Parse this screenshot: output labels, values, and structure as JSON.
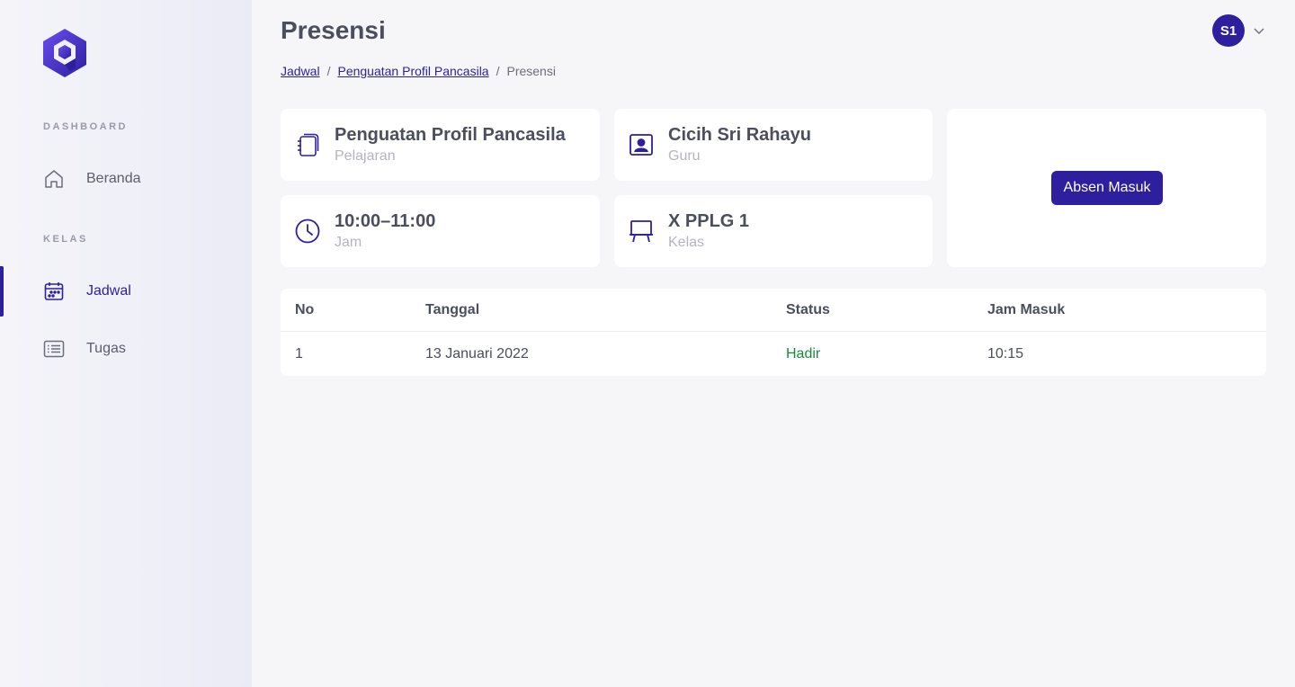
{
  "colors": {
    "primary": "#2d1f9e",
    "success": "#1a8a3e"
  },
  "sidebar": {
    "sections": [
      {
        "label": "DASHBOARD",
        "items": [
          {
            "label": "Beranda",
            "icon": "home-icon",
            "active": false
          }
        ]
      },
      {
        "label": "KELAS",
        "items": [
          {
            "label": "Jadwal",
            "icon": "calendar-icon",
            "active": true
          },
          {
            "label": "Tugas",
            "icon": "list-icon",
            "active": false
          }
        ]
      }
    ]
  },
  "header": {
    "title": "Presensi",
    "breadcrumb": [
      "Jadwal",
      "Penguatan Profil Pancasila",
      "Presensi"
    ],
    "avatar_initials": "S1"
  },
  "info": {
    "subject": {
      "value": "Penguatan Profil Pancasila",
      "label": "Pelajaran",
      "icon": "notebook-icon"
    },
    "teacher": {
      "value": "Cicih Sri Rahayu",
      "label": "Guru",
      "icon": "teacher-icon"
    },
    "time": {
      "value": "10:00–11:00",
      "label": "Jam",
      "icon": "clock-icon"
    },
    "class": {
      "value": "X PPLG 1",
      "label": "Kelas",
      "icon": "board-icon"
    }
  },
  "action": {
    "button_label": "Absen Masuk"
  },
  "table": {
    "columns": [
      "No",
      "Tanggal",
      "Status",
      "Jam Masuk"
    ],
    "rows": [
      [
        "1",
        "13 Januari 2022",
        "Hadir",
        "10:15"
      ]
    ]
  }
}
